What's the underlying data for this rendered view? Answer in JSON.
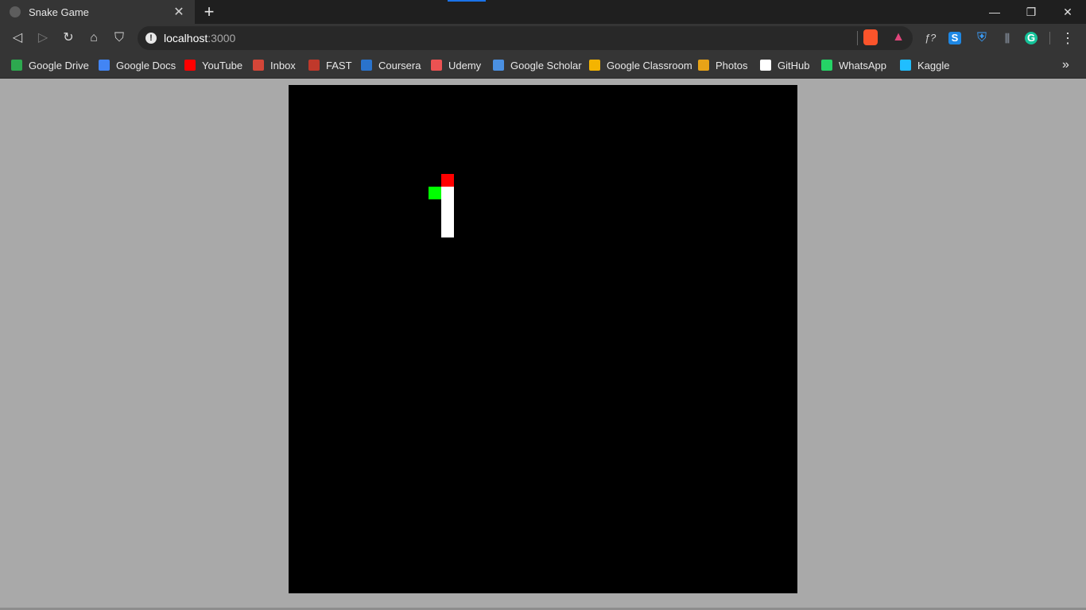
{
  "tab": {
    "title": "Snake Game",
    "close": "✕"
  },
  "newtab": "+",
  "window_controls": {
    "minimize": "—",
    "restore": "❐",
    "close": "✕"
  },
  "url": {
    "host": "localhost",
    "port": ":3000"
  },
  "nav": {
    "back": "◁",
    "forward": "▷",
    "reload": "↻",
    "home": "⌂",
    "bookmark": "⛉"
  },
  "extensions": {
    "f": "ƒ?",
    "s": "S",
    "g": "G",
    "menu": "⋮"
  },
  "bookmarks": [
    {
      "label": "Google Drive",
      "icon": "drive-icon",
      "color": "#2da94f"
    },
    {
      "label": "Google Docs",
      "icon": "docs-icon",
      "color": "#4285f4"
    },
    {
      "label": "YouTube",
      "icon": "youtube-icon",
      "color": "#ff0000"
    },
    {
      "label": "Inbox",
      "icon": "gmail-icon",
      "color": "#d44638"
    },
    {
      "label": "FAST",
      "icon": "fast-icon",
      "color": "#c0392b"
    },
    {
      "label": "Coursera",
      "icon": "coursera-icon",
      "color": "#2a73cc"
    },
    {
      "label": "Udemy",
      "icon": "udemy-icon",
      "color": "#ec5252"
    },
    {
      "label": "Google Scholar",
      "icon": "scholar-icon",
      "color": "#4a90e2"
    },
    {
      "label": "Google Classroom",
      "icon": "classroom-icon",
      "color": "#f4b400"
    },
    {
      "label": "Photos",
      "icon": "photos-icon",
      "color": "#e8a317"
    },
    {
      "label": "GitHub",
      "icon": "github-icon",
      "color": "#ffffff"
    },
    {
      "label": "WhatsApp",
      "icon": "whatsapp-icon",
      "color": "#25d366"
    },
    {
      "label": "Kaggle",
      "icon": "kaggle-icon",
      "color": "#20beff"
    }
  ],
  "overflow": "»",
  "game": {
    "grid_cols": 40,
    "grid_rows": 40,
    "background": "#000000",
    "food": {
      "col": 12,
      "row": 7,
      "color": "#ff0000"
    },
    "snake_head": {
      "col": 11,
      "row": 8,
      "color": "#00ff00"
    },
    "snake_body": [
      {
        "col": 12,
        "row": 8
      },
      {
        "col": 12,
        "row": 9
      },
      {
        "col": 12,
        "row": 10
      },
      {
        "col": 12,
        "row": 11
      }
    ],
    "snake_body_color": "#ffffff"
  }
}
